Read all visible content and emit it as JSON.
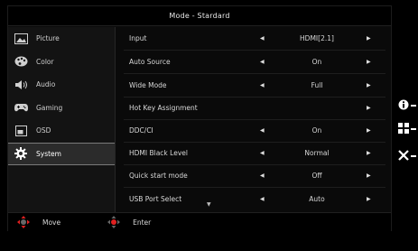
{
  "window": {
    "title": "Mode - Stardard"
  },
  "sidebar": {
    "items": [
      {
        "label": "Picture",
        "icon": "picture-icon"
      },
      {
        "label": "Color",
        "icon": "palette-icon"
      },
      {
        "label": "Audio",
        "icon": "speaker-icon"
      },
      {
        "label": "Gaming",
        "icon": "gamepad-icon"
      },
      {
        "label": "OSD",
        "icon": "osd-icon"
      },
      {
        "label": "System",
        "icon": "gear-icon",
        "active": true
      }
    ]
  },
  "settings": [
    {
      "label": "Input",
      "value": "HDMI[2.1]"
    },
    {
      "label": "Auto Source",
      "value": "On"
    },
    {
      "label": "Wide Mode",
      "value": "Full"
    },
    {
      "label": "Hot Key Assignment",
      "value": ""
    },
    {
      "label": "DDC/CI",
      "value": "On"
    },
    {
      "label": "HDMI Black Level",
      "value": "Normal"
    },
    {
      "label": "Quick start mode",
      "value": "Off"
    },
    {
      "label": "USB Port Select",
      "value": "Auto"
    }
  ],
  "footer": {
    "move_label": "Move",
    "enter_label": "Enter"
  },
  "hotkeys": [
    "info-icon",
    "grid-icon",
    "close-icon"
  ],
  "colors": {
    "active_border": "#7a7a7a",
    "background": "#0a0a0a"
  }
}
